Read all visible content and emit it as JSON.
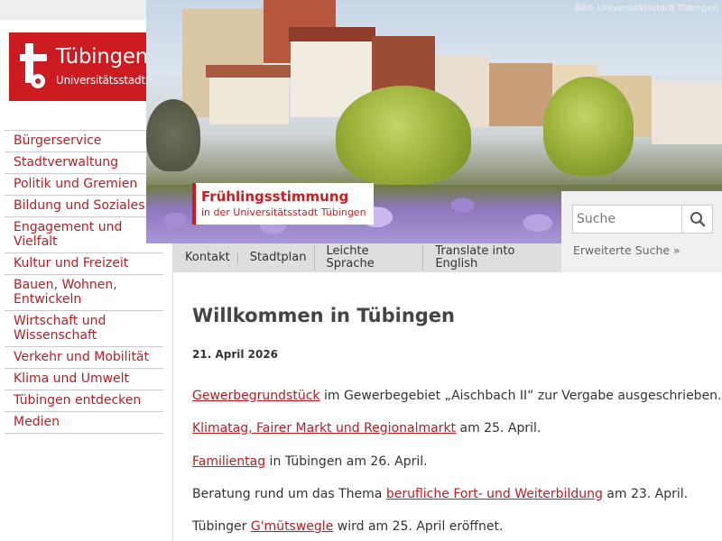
{
  "logo": {
    "title": "Tübingen",
    "subtitle": "Universitätsstadt",
    "color": "#cc1c21"
  },
  "hero": {
    "credit": "Bild: Universitätsstadt Tübingen",
    "caption_title": "Frühlingsstimmung",
    "caption_sub": "in der Universitätsstadt Tübingen"
  },
  "sidebar": {
    "items": [
      {
        "label": "Bürgerservice"
      },
      {
        "label": "Stadtverwaltung"
      },
      {
        "label": "Politik und Gremien"
      },
      {
        "label": "Bildung und Soziales"
      },
      {
        "label": "Engagement und Vielfalt"
      },
      {
        "label": "Kultur und Freizeit"
      },
      {
        "label": "Bauen, Wohnen, Entwickeln"
      },
      {
        "label": "Wirtschaft und Wissenschaft"
      },
      {
        "label": "Verkehr und Mobilität"
      },
      {
        "label": "Klima und Umwelt"
      },
      {
        "label": "Tübingen entdecken"
      },
      {
        "label": "Medien"
      }
    ]
  },
  "quicklinks": [
    {
      "label": "Kontakt"
    },
    {
      "label": "Stadtplan"
    },
    {
      "label": "Leichte Sprache"
    },
    {
      "label": "Translate into English"
    }
  ],
  "search": {
    "placeholder": "Suche",
    "advanced": "Erweiterte Suche »",
    "icon": "search-icon"
  },
  "main": {
    "title": "Willkommen in Tübingen",
    "date": "21. April 2026",
    "news": [
      {
        "link": "Gewerbegrundstück",
        "before": "",
        "after": " im Gewerbegebiet „Aischbach II“ zur Vergabe ausgeschrieben."
      },
      {
        "link": "Klimatag, Fairer Markt und Regionalmarkt",
        "before": "",
        "after": " am 25. April."
      },
      {
        "link": "Familientag",
        "before": "",
        "after": " in Tübingen am 26. April."
      },
      {
        "link": "berufliche Fort- und Weiterbildung",
        "before": "Beratung rund um das Thema ",
        "after": " am 23. April."
      },
      {
        "link": "G'mütswegle",
        "before": "Tübinger ",
        "after": " wird am 25. April eröffnet."
      }
    ]
  },
  "colors": {
    "accent": "#cc1c21",
    "link": "#b51f24",
    "bar": "#dedede"
  }
}
